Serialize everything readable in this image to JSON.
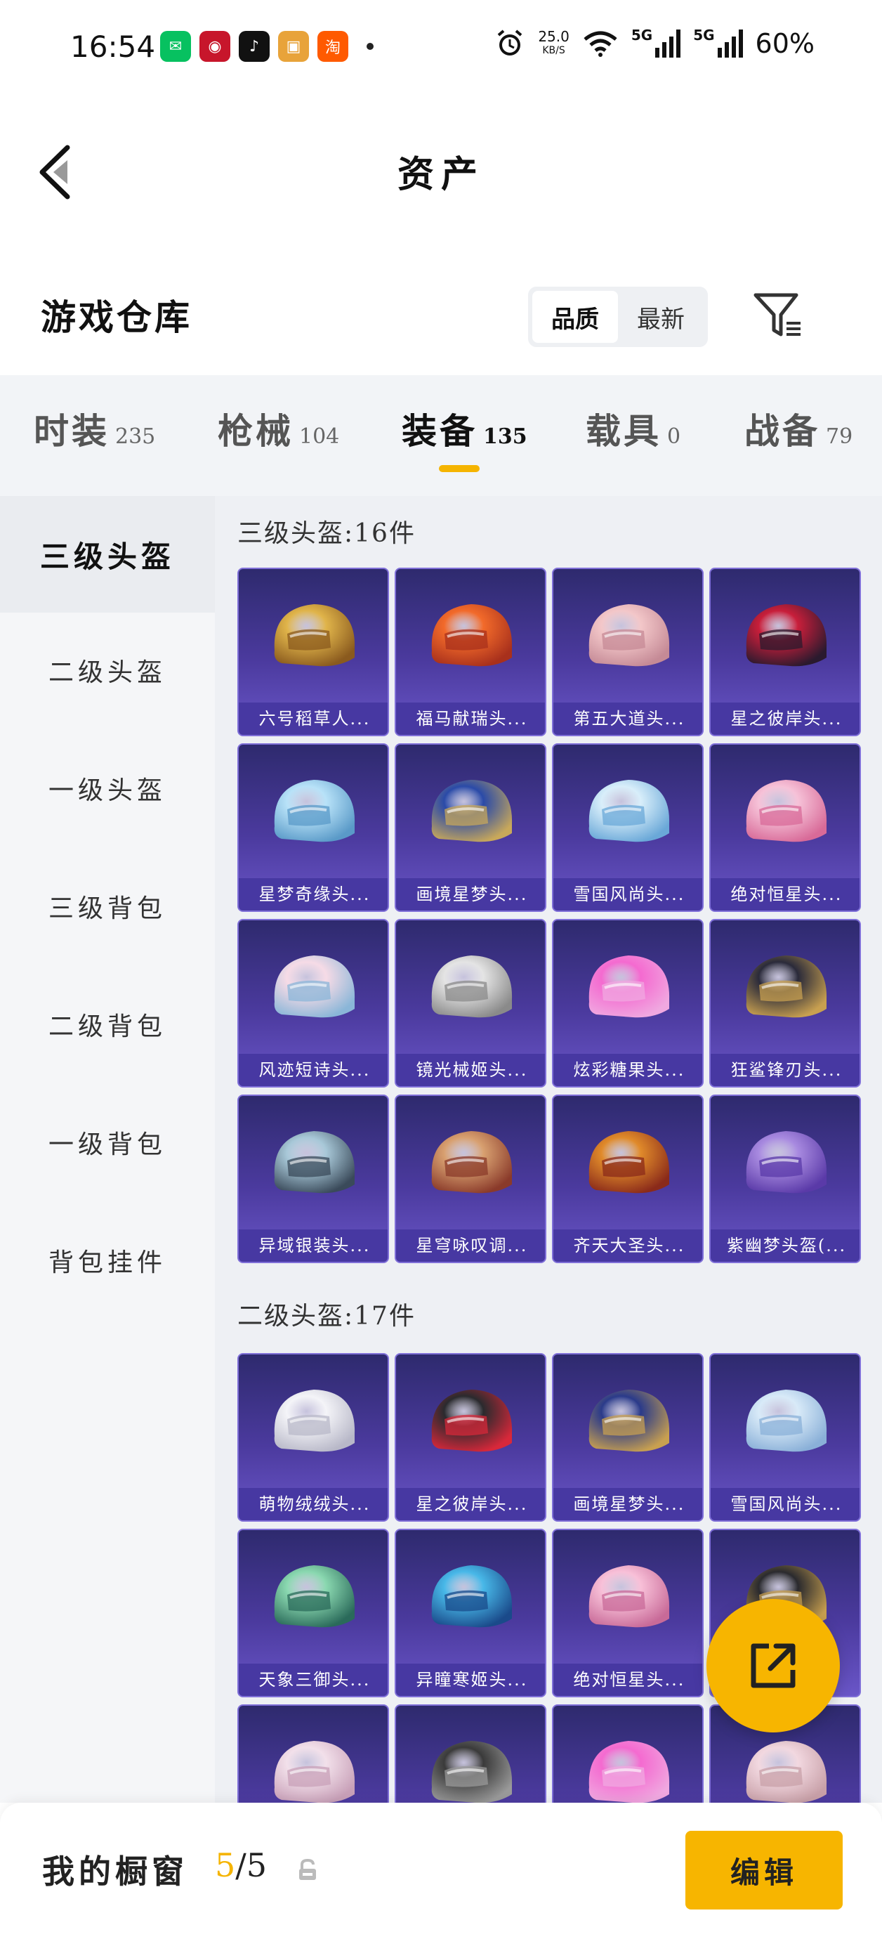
{
  "status_bar": {
    "time": "16:54",
    "apps": [
      {
        "icon": "wechat-icon",
        "glyph": "✉",
        "color": "#07c160"
      },
      {
        "icon": "bank-icon",
        "glyph": "◉",
        "color": "#c7162b"
      },
      {
        "icon": "tiktok-icon",
        "glyph": "♪",
        "color": "#111111"
      },
      {
        "icon": "game-icon",
        "glyph": "▣",
        "color": "#e8a33a"
      },
      {
        "icon": "taobao-icon",
        "glyph": "淘",
        "color": "#ff5a00"
      }
    ],
    "net_speed": "25.0",
    "net_unit": "KB/S",
    "net_type_1": "5G",
    "net_type_2": "5G",
    "battery": "60%"
  },
  "header": {
    "title": "资产",
    "back_icon": "back-arrow-icon"
  },
  "warehouse": {
    "title": "游戏仓库",
    "sort_options": [
      "品质",
      "最新"
    ],
    "sort_active": 0,
    "filter_icon": "filter-icon"
  },
  "categories": [
    {
      "name": "时装",
      "count": "235"
    },
    {
      "name": "枪械",
      "count": "104"
    },
    {
      "name": "装备",
      "count": "135"
    },
    {
      "name": "载具",
      "count": "0"
    },
    {
      "name": "战备",
      "count": "79"
    }
  ],
  "active_category": 2,
  "side_nav": [
    "三级头盔",
    "二级头盔",
    "一级头盔",
    "三级背包",
    "二级背包",
    "一级背包",
    "背包挂件"
  ],
  "sections": [
    {
      "title": "三级头盔:16件",
      "items": [
        {
          "name": "六号稻草人...",
          "c1": "#e0b44a",
          "c2": "#8a5a1e"
        },
        {
          "name": "福马献瑞头...",
          "c1": "#f26a2a",
          "c2": "#a8301c"
        },
        {
          "name": "第五大道头...",
          "c1": "#f3c7c9",
          "c2": "#c58a96"
        },
        {
          "name": "星之彼岸头...",
          "c1": "#c81e3a",
          "c2": "#2a1a2e"
        },
        {
          "name": "星梦奇缘头...",
          "c1": "#b8e2f8",
          "c2": "#5a9ac8"
        },
        {
          "name": "画境星梦头...",
          "c1": "#2a4aa8",
          "c2": "#c8a85a"
        },
        {
          "name": "雪国风尚头...",
          "c1": "#d8eefa",
          "c2": "#6aa8d8"
        },
        {
          "name": "绝对恒星头...",
          "c1": "#f6c2d8",
          "c2": "#d86a98"
        },
        {
          "name": "风迹短诗头...",
          "c1": "#f6dbe6",
          "c2": "#8ab6d8"
        },
        {
          "name": "镜光械姬头...",
          "c1": "#e4e4e4",
          "c2": "#8a8a8a"
        },
        {
          "name": "炫彩糖果头...",
          "c1": "#f46ad0",
          "c2": "#f0a8e0"
        },
        {
          "name": "狂鲨锋刃头...",
          "c1": "#2a2a3a",
          "c2": "#c8a050"
        },
        {
          "name": "异域银装头...",
          "c1": "#a8c8d8",
          "c2": "#3a4a5a"
        },
        {
          "name": "星穹咏叹调...",
          "c1": "#d8a070",
          "c2": "#8a3a2a"
        },
        {
          "name": "齐天大圣头...",
          "c1": "#e08a2a",
          "c2": "#8a2a1a"
        },
        {
          "name": "紫幽梦头盔(...",
          "c1": "#a88ae0",
          "c2": "#5a3aa8"
        }
      ]
    },
    {
      "title": "二级头盔:17件",
      "items": [
        {
          "name": "萌物绒绒头...",
          "c1": "#f4f4f8",
          "c2": "#b8b8c8"
        },
        {
          "name": "星之彼岸头...",
          "c1": "#2a2a2e",
          "c2": "#d8283a"
        },
        {
          "name": "画境星梦头...",
          "c1": "#2a3a8a",
          "c2": "#c8a050"
        },
        {
          "name": "雪国风尚头...",
          "c1": "#d8eaf8",
          "c2": "#8ab0d8"
        },
        {
          "name": "天象三御头...",
          "c1": "#8ad8b0",
          "c2": "#2a6a5a"
        },
        {
          "name": "异瞳寒姬头...",
          "c1": "#48b8e8",
          "c2": "#1a4a8a"
        },
        {
          "name": "绝对恒星头...",
          "c1": "#f8c0d8",
          "c2": "#c86a98"
        },
        {
          "name": "",
          "c1": "#2a2a2e",
          "c2": "#c8a050"
        },
        {
          "name": "",
          "c1": "#f2e0ea",
          "c2": "#c8a0b8"
        },
        {
          "name": "",
          "c1": "#3a3a3a",
          "c2": "#9a9a9a"
        },
        {
          "name": "",
          "c1": "#f46ad0",
          "c2": "#f0a8e0"
        },
        {
          "name": "",
          "c1": "#f2d8e0",
          "c2": "#c8a0a8"
        }
      ]
    }
  ],
  "fab_icon": "share-external-icon",
  "bottom_bar": {
    "label": "我的橱窗",
    "current": "5",
    "separator": "/",
    "total": "5",
    "lock_icon": "lock-icon",
    "edit_label": "编辑"
  }
}
